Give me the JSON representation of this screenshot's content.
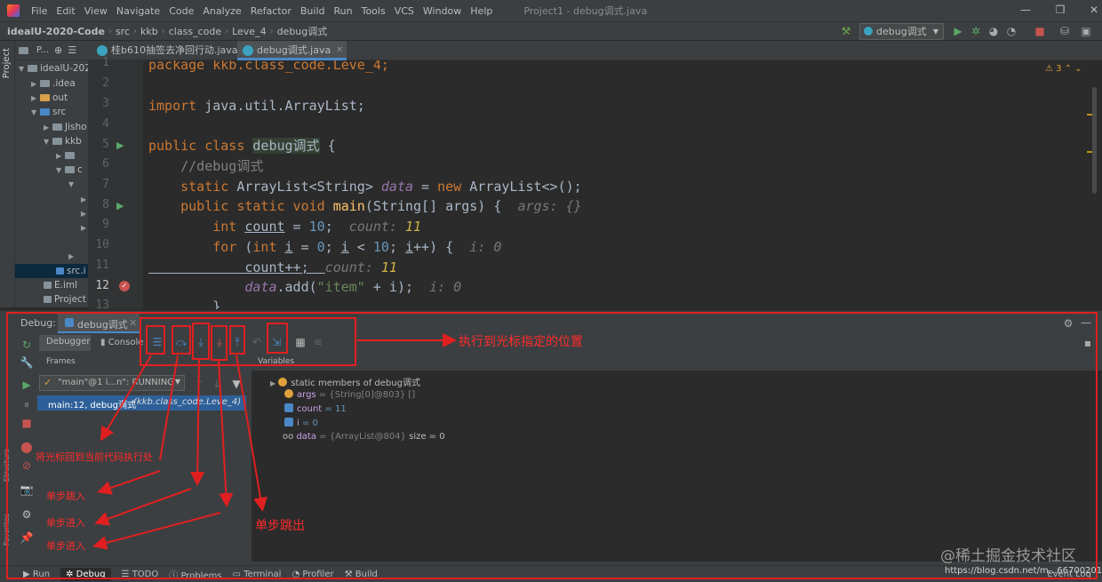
{
  "menubar": {
    "items": [
      "File",
      "Edit",
      "View",
      "Navigate",
      "Code",
      "Analyze",
      "Refactor",
      "Build",
      "Run",
      "Tools",
      "VCS",
      "Window",
      "Help"
    ],
    "window_title": "Project1 - debug调式.java"
  },
  "navbar": {
    "crumbs": [
      "idealU-2020-Code",
      "src",
      "kkb",
      "class_code",
      "Leve_4",
      "debug调式"
    ],
    "run_config": "debug调式"
  },
  "left_stripe_label": "Project",
  "project": {
    "header": "P...",
    "rows": [
      {
        "label": "idealU-202",
        "icon": "folder"
      },
      {
        "label": ".idea",
        "icon": "folder"
      },
      {
        "label": "out",
        "icon": "folder-orange"
      },
      {
        "label": "src",
        "icon": "folder-blue"
      },
      {
        "label": "Jisho",
        "icon": "folder"
      },
      {
        "label": "kkb",
        "icon": "folder"
      },
      {
        "label": "",
        "icon": "folder"
      },
      {
        "label": "c",
        "icon": "folder"
      },
      {
        "label": "src.i",
        "icon": "file"
      },
      {
        "label": "E.iml",
        "icon": "file"
      },
      {
        "label": "Project",
        "icon": "file"
      }
    ]
  },
  "tabs": [
    {
      "label": "桂b610抽签去净回行动.java"
    },
    {
      "label": "debug调式.java"
    }
  ],
  "editor": {
    "warning_count": "3",
    "line_numbers": [
      "1",
      "2",
      "3",
      "4",
      "5",
      "6",
      "7",
      "8",
      "9",
      "10",
      "11",
      "12",
      "13"
    ],
    "code": {
      "l1": "package kkb.class_code.Leve_4;",
      "l3_kw": "import",
      "l3_rest": " java.util.ArrayList;",
      "l5_kw": "public class ",
      "l5_cls": "debug调式",
      "l5_rest": " {",
      "l6": "    //debug调式",
      "l7_kw": "    static ",
      "l7_type": "ArrayList<String> ",
      "l7_fld": "data",
      "l7_eq": " = ",
      "l7_new": "new ",
      "l7_rest": "ArrayList<>();",
      "l8_kw": "    public static void ",
      "l8_fn": "main",
      "l8_rest": "(String[] args) {  ",
      "l8_hint": "args: {}",
      "l9_kw": "        int ",
      "l9_var": "count",
      "l9_eq": " = ",
      "l9_num": "10",
      "l9_semi": ";  ",
      "l9_hint": "count: ",
      "l9_hintv": "11",
      "l10_kw": "        for ",
      "l10_a": "(",
      "l10_kw2": "int ",
      "l10_i": "i",
      "l10_b": " = ",
      "l10_n0": "0",
      "l10_c": "; ",
      "l10_i2": "i",
      "l10_d": " < ",
      "l10_n10": "10",
      "l10_e": "; ",
      "l10_i3": "i",
      "l10_f": "++) {  ",
      "l10_hint": "i: 0",
      "l11_a": "            count++;  ",
      "l11_hint": "count: ",
      "l11_hintv": "11",
      "l12_fld": "            data",
      "l12_a": ".add(",
      "l12_str": "\"item\"",
      "l12_b": " + i);  ",
      "l12_hint": "i: 0",
      "l13": "        }"
    }
  },
  "debug": {
    "title": "Debug:",
    "session_tab": "debug调式",
    "subtabs": [
      "Debugger",
      "Console"
    ],
    "frames_label": "Frames",
    "variables_label": "Variables",
    "thread": "\"main\"@1 i...n\": RUNNING",
    "frame": "main:12, debug调式",
    "frame_pkg": "(kkb.class_code.Leve_4)",
    "variables": [
      {
        "icon": "static",
        "name": "static members of debug调式",
        "value": "",
        "extra": ""
      },
      {
        "icon": "p",
        "name": "args",
        "value": " = {String[0]@803} []",
        "extra": ""
      },
      {
        "icon": "i",
        "name": "count",
        "value": " = 11",
        "extra": ""
      },
      {
        "icon": "i",
        "name": "i",
        "value": " = 0",
        "extra": ""
      },
      {
        "icon": "oo",
        "name": "data",
        "value": " = {ArrayList@804}",
        "extra": " size = 0"
      }
    ]
  },
  "bottombar": {
    "items": [
      "Run",
      "Debug",
      "TODO",
      "Problems",
      "Terminal",
      "Profiler",
      "Build"
    ],
    "right_item": "Event Log"
  },
  "side_labels": {
    "structure": "Structure",
    "favorites": "Favorites"
  },
  "annotations": {
    "run_to_cursor": "执行到光标指定的位置",
    "show_execution_point": "将光标回到当前代码执行处",
    "step_over": "单步跳入",
    "step_into": "单步进入",
    "force_step_into": "单步进入",
    "step_out": "单步跳出"
  },
  "watermark": "@稀土掘金技术社区",
  "url": "https://blog.csdn.net/m...667002013",
  "colors": {
    "annotation_red": "#e02020",
    "execution_line": "#2d6099",
    "keyword": "#cc7832",
    "function": "#ffc66d"
  }
}
